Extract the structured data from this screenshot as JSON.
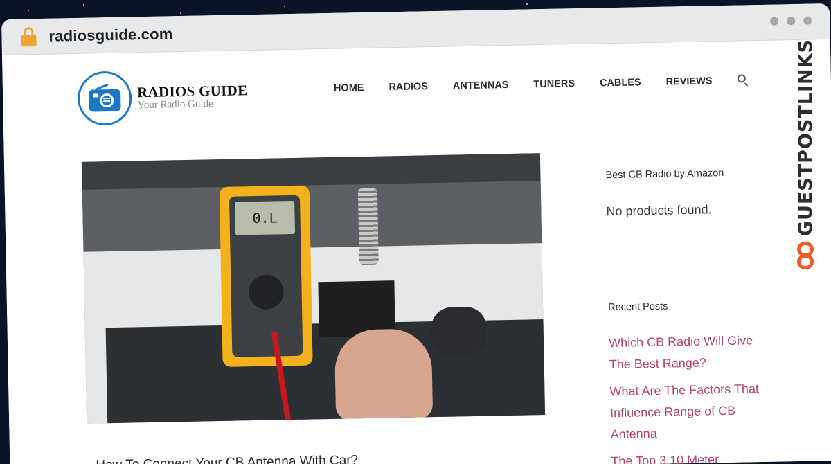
{
  "browser": {
    "url": "radiosguide.com"
  },
  "site": {
    "logo_title": "RADIOS GUIDE",
    "logo_subtitle": "Your Radio Guide"
  },
  "nav": {
    "items": [
      {
        "label": "HOME"
      },
      {
        "label": "RADIOS"
      },
      {
        "label": "ANTENNAS"
      },
      {
        "label": "TUNERS"
      },
      {
        "label": "CABLES"
      },
      {
        "label": "REVIEWS"
      }
    ]
  },
  "hero": {
    "meter_display": "0.L"
  },
  "post": {
    "title": "How To Connect Your CB Antenna With Car?"
  },
  "sidebar": {
    "widget_title": "Best CB Radio by Amazon",
    "no_products": "No products found.",
    "recent_title": "Recent Posts",
    "recent_posts": [
      {
        "title": "Which CB Radio Will Give The Best Range?"
      },
      {
        "title": "What Are The Factors That Influence Range of CB Antenna"
      },
      {
        "title": "The Top 3 10 Meter"
      }
    ]
  },
  "watermark": {
    "text": "GUESTPOSTLINKS"
  },
  "colors": {
    "accent": "#b5456b",
    "brand_blue": "#1b78c5",
    "watermark_orange": "#f15a24",
    "lock": "#f0a433"
  }
}
